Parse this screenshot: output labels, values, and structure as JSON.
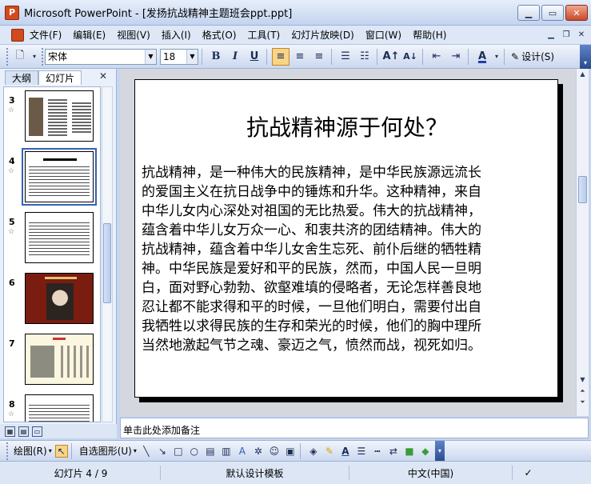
{
  "window": {
    "title": "Microsoft PowerPoint - [发扬抗战精神主题班会ppt.ppt]",
    "app_badge": "P"
  },
  "menu": [
    "文件(F)",
    "编辑(E)",
    "视图(V)",
    "插入(I)",
    "格式(O)",
    "工具(T)",
    "幻灯片放映(D)",
    "窗口(W)",
    "帮助(H)"
  ],
  "toolbar": {
    "font_name": "宋体",
    "font_size": "18",
    "bold": "B",
    "italic": "I",
    "underline": "U",
    "design_label": "设计(S)"
  },
  "left_pane": {
    "tabs": [
      "大纲",
      "幻灯片"
    ],
    "selected_slide": 4,
    "thumbnails": [
      {
        "number": "3",
        "style": "photo-text"
      },
      {
        "number": "4",
        "style": "text"
      },
      {
        "number": "5",
        "style": "text"
      },
      {
        "number": "6",
        "style": "portrait-red"
      },
      {
        "number": "7",
        "style": "photo-calligraphy"
      },
      {
        "number": "8",
        "style": "text"
      }
    ]
  },
  "slide": {
    "title": "抗战精神源于何处？",
    "body_lines": [
      "抗战精神，是一种伟大的民族精神，是中华民族源远流长",
      "的爱国主义在抗日战争中的锤炼和升华。这种精神，来自",
      "中华儿女内心深处对祖国的无比热爱。伟大的抗战精神，",
      "蕴含着中华儿女万众一心、和衷共济的团结精神。伟大的",
      "抗战精神，蕴含着中华儿女舍生忘死、前仆后继的牺牲精",
      "神。中华民族是爱好和平的民族，然而，中国人民一旦明",
      "白，面对野心勃勃、欲壑难填的侵略者，无论怎样善良地",
      "忍让都不能求得和平的时候，一旦他们明白，需要付出自",
      "我牺牲以求得民族的生存和荣光的时候，他们的胸中理所",
      "当然地激起气节之魂、豪迈之气，愤然而战，视死如归。"
    ]
  },
  "notes_placeholder": "单击此处添加备注",
  "drawing_toolbar": {
    "draw_label": "绘图(R)",
    "autoshape_label": "自选图形(U)"
  },
  "status": {
    "slide_position": "幻灯片 4 / 9",
    "template": "默认设计模板",
    "language": "中文(中国)"
  },
  "colors": {
    "selection": "#3463b5",
    "active_button": "#f8d486",
    "title_bar_top": "#e6eefa"
  }
}
